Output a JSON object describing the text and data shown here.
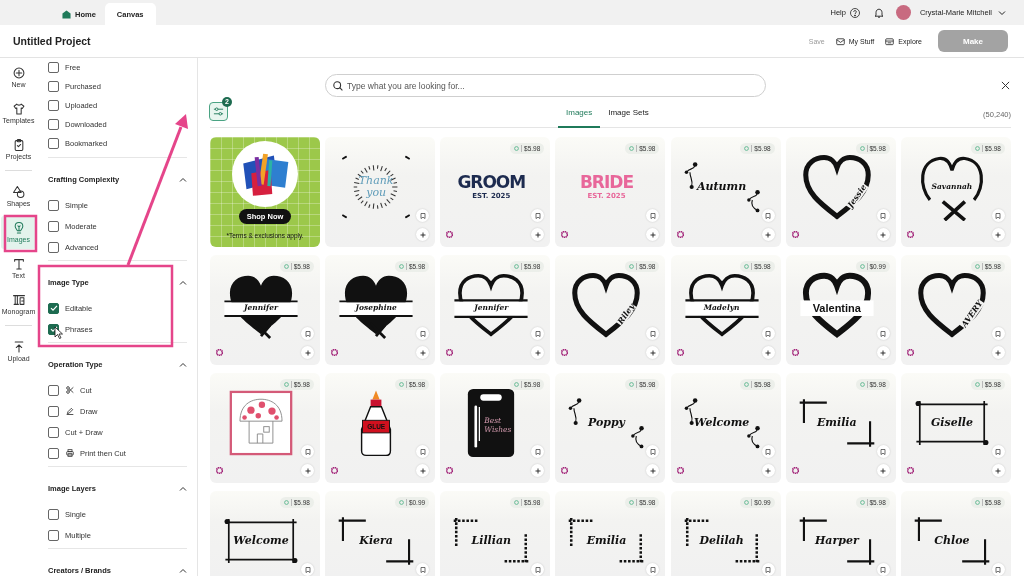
{
  "app_tabs": [
    {
      "label": "Home",
      "selected": false
    },
    {
      "label": "Canvas",
      "selected": true
    }
  ],
  "account": {
    "help": "Help",
    "user_name": "Crystal-Marie Mitchell"
  },
  "project_bar": {
    "title": "Untitled Project",
    "actions": [
      {
        "kind": "text",
        "label": "Save",
        "disabled": true
      },
      {
        "kind": "link",
        "label": "My Stuff",
        "disabled": false
      },
      {
        "kind": "link",
        "label": "Explore",
        "disabled": false
      },
      {
        "kind": "primary",
        "label": "Make",
        "disabled": true
      }
    ]
  },
  "nav_groups": [
    [
      {
        "label": "New",
        "selected": false
      },
      {
        "label": "Templates",
        "selected": false
      },
      {
        "label": "Projects",
        "selected": false
      }
    ],
    [
      {
        "label": "Shapes",
        "selected": false
      },
      {
        "label": "Images",
        "selected": true
      },
      {
        "label": "Text",
        "selected": false
      },
      {
        "label": "Monogram",
        "selected": false
      }
    ],
    [
      {
        "label": "Upload",
        "selected": false
      }
    ]
  ],
  "filters": [
    {
      "items": [
        {
          "label": "Free",
          "checked": false
        },
        {
          "label": "Purchased",
          "checked": false
        },
        {
          "label": "Uploaded",
          "checked": false
        },
        {
          "label": "Downloaded",
          "checked": false
        },
        {
          "label": "Bookmarked",
          "checked": false
        }
      ]
    },
    {
      "title": "Crafting Complexity",
      "expanded": true,
      "items": [
        {
          "label": "Simple",
          "checked": false
        },
        {
          "label": "Moderate",
          "checked": false
        },
        {
          "label": "Advanced",
          "checked": false
        }
      ]
    },
    {
      "title": "Image Type",
      "expanded": true,
      "items": [
        {
          "label": "Editable",
          "checked": true
        },
        {
          "label": "Phrases",
          "checked": true
        }
      ]
    },
    {
      "title": "Operation Type",
      "expanded": true,
      "items": [
        {
          "label": "Cut",
          "checked": false
        },
        {
          "label": "Draw",
          "checked": false
        },
        {
          "label": "Cut + Draw",
          "checked": false
        },
        {
          "label": "Print then Cut",
          "checked": false
        }
      ]
    },
    {
      "title": "Image Layers",
      "expanded": true,
      "items": [
        {
          "label": "Single",
          "checked": false
        },
        {
          "label": "Multiple",
          "checked": false
        }
      ]
    },
    {
      "title": "Creators / Brands",
      "expanded": true
    }
  ],
  "search": {
    "placeholder": "Type what you are looking for..."
  },
  "filter_button": {
    "badge": "2"
  },
  "result_tabs": [
    {
      "label": "Images",
      "selected": true
    },
    {
      "label": "Image Sets",
      "selected": false
    }
  ],
  "result_count": "(50,240)",
  "cards": [
    {
      "kind": "ad",
      "button": "Shop Now",
      "note": "*Terms & exclusions apply."
    },
    {
      "kind": "burst",
      "text": "Thank you",
      "corner_mark": false
    },
    {
      "kind": "varsity",
      "text": "GROOM",
      "subtext": "EST. 2025",
      "color": "#1d2b4f",
      "price": "$5.98",
      "corner_mark": true
    },
    {
      "kind": "varsity",
      "text": "BRIDE",
      "subtext": "EST. 2025",
      "color": "#e8679a",
      "price": "$5.98",
      "corner_mark": true
    },
    {
      "kind": "floral",
      "text": "Autumn",
      "price": "$5.98",
      "corner_mark": true
    },
    {
      "kind": "heart_side",
      "text": "Jessie",
      "price": "$5.98",
      "corner_mark": true
    },
    {
      "kind": "heart_cross",
      "text": "Savannah",
      "price": "$5.98",
      "corner_mark": true
    },
    {
      "kind": "heart_solid",
      "text": "Jennifer",
      "price": "$5.98",
      "corner_mark": true
    },
    {
      "kind": "heart_solid",
      "text": "Josephine",
      "price": "$5.98",
      "corner_mark": true
    },
    {
      "kind": "heart_split",
      "text": "Jennifer",
      "price": "$5.98",
      "corner_mark": true
    },
    {
      "kind": "heart_side",
      "text": "Riley",
      "price": "$5.98",
      "corner_mark": true
    },
    {
      "kind": "heart_split",
      "text": "Madelyn",
      "price": "$5.98",
      "corner_mark": true
    },
    {
      "kind": "heart_bold",
      "text": "Valentina",
      "price": "$0.99",
      "corner_mark": true
    },
    {
      "kind": "heart_side",
      "text": "AVERY",
      "price": "$5.98",
      "corner_mark": true
    },
    {
      "kind": "mushroom",
      "price": "$5.98",
      "corner_mark": true
    },
    {
      "kind": "glue",
      "text": "GLUE",
      "price": "$5.98",
      "corner_mark": true
    },
    {
      "kind": "tag",
      "text": "Best Wishes",
      "price": "$5.98",
      "corner_mark": true
    },
    {
      "kind": "floral",
      "text": "Poppy",
      "price": "$5.98",
      "corner_mark": true
    },
    {
      "kind": "floral",
      "text": "Welcome",
      "price": "$5.98",
      "corner_mark": true
    },
    {
      "kind": "frame_corners",
      "text": "Emilia",
      "price": "$5.98",
      "corner_mark": true
    },
    {
      "kind": "frame_box",
      "text": "Giselle",
      "price": "$5.98",
      "corner_mark": true
    },
    {
      "kind": "frame_box",
      "text": "Welcome",
      "price": "$5.98"
    },
    {
      "kind": "frame_corners",
      "text": "Kiera",
      "price": "$0.99"
    },
    {
      "kind": "frame_beads",
      "text": "Lillian",
      "price": "$5.98"
    },
    {
      "kind": "frame_beads",
      "text": "Emilia",
      "price": "$5.98"
    },
    {
      "kind": "frame_beads",
      "text": "Delilah",
      "price": "$0.99"
    },
    {
      "kind": "frame_corners",
      "text": "Harper",
      "price": "$5.98"
    },
    {
      "kind": "frame_corners",
      "text": "Chloe",
      "price": "$5.98"
    }
  ]
}
